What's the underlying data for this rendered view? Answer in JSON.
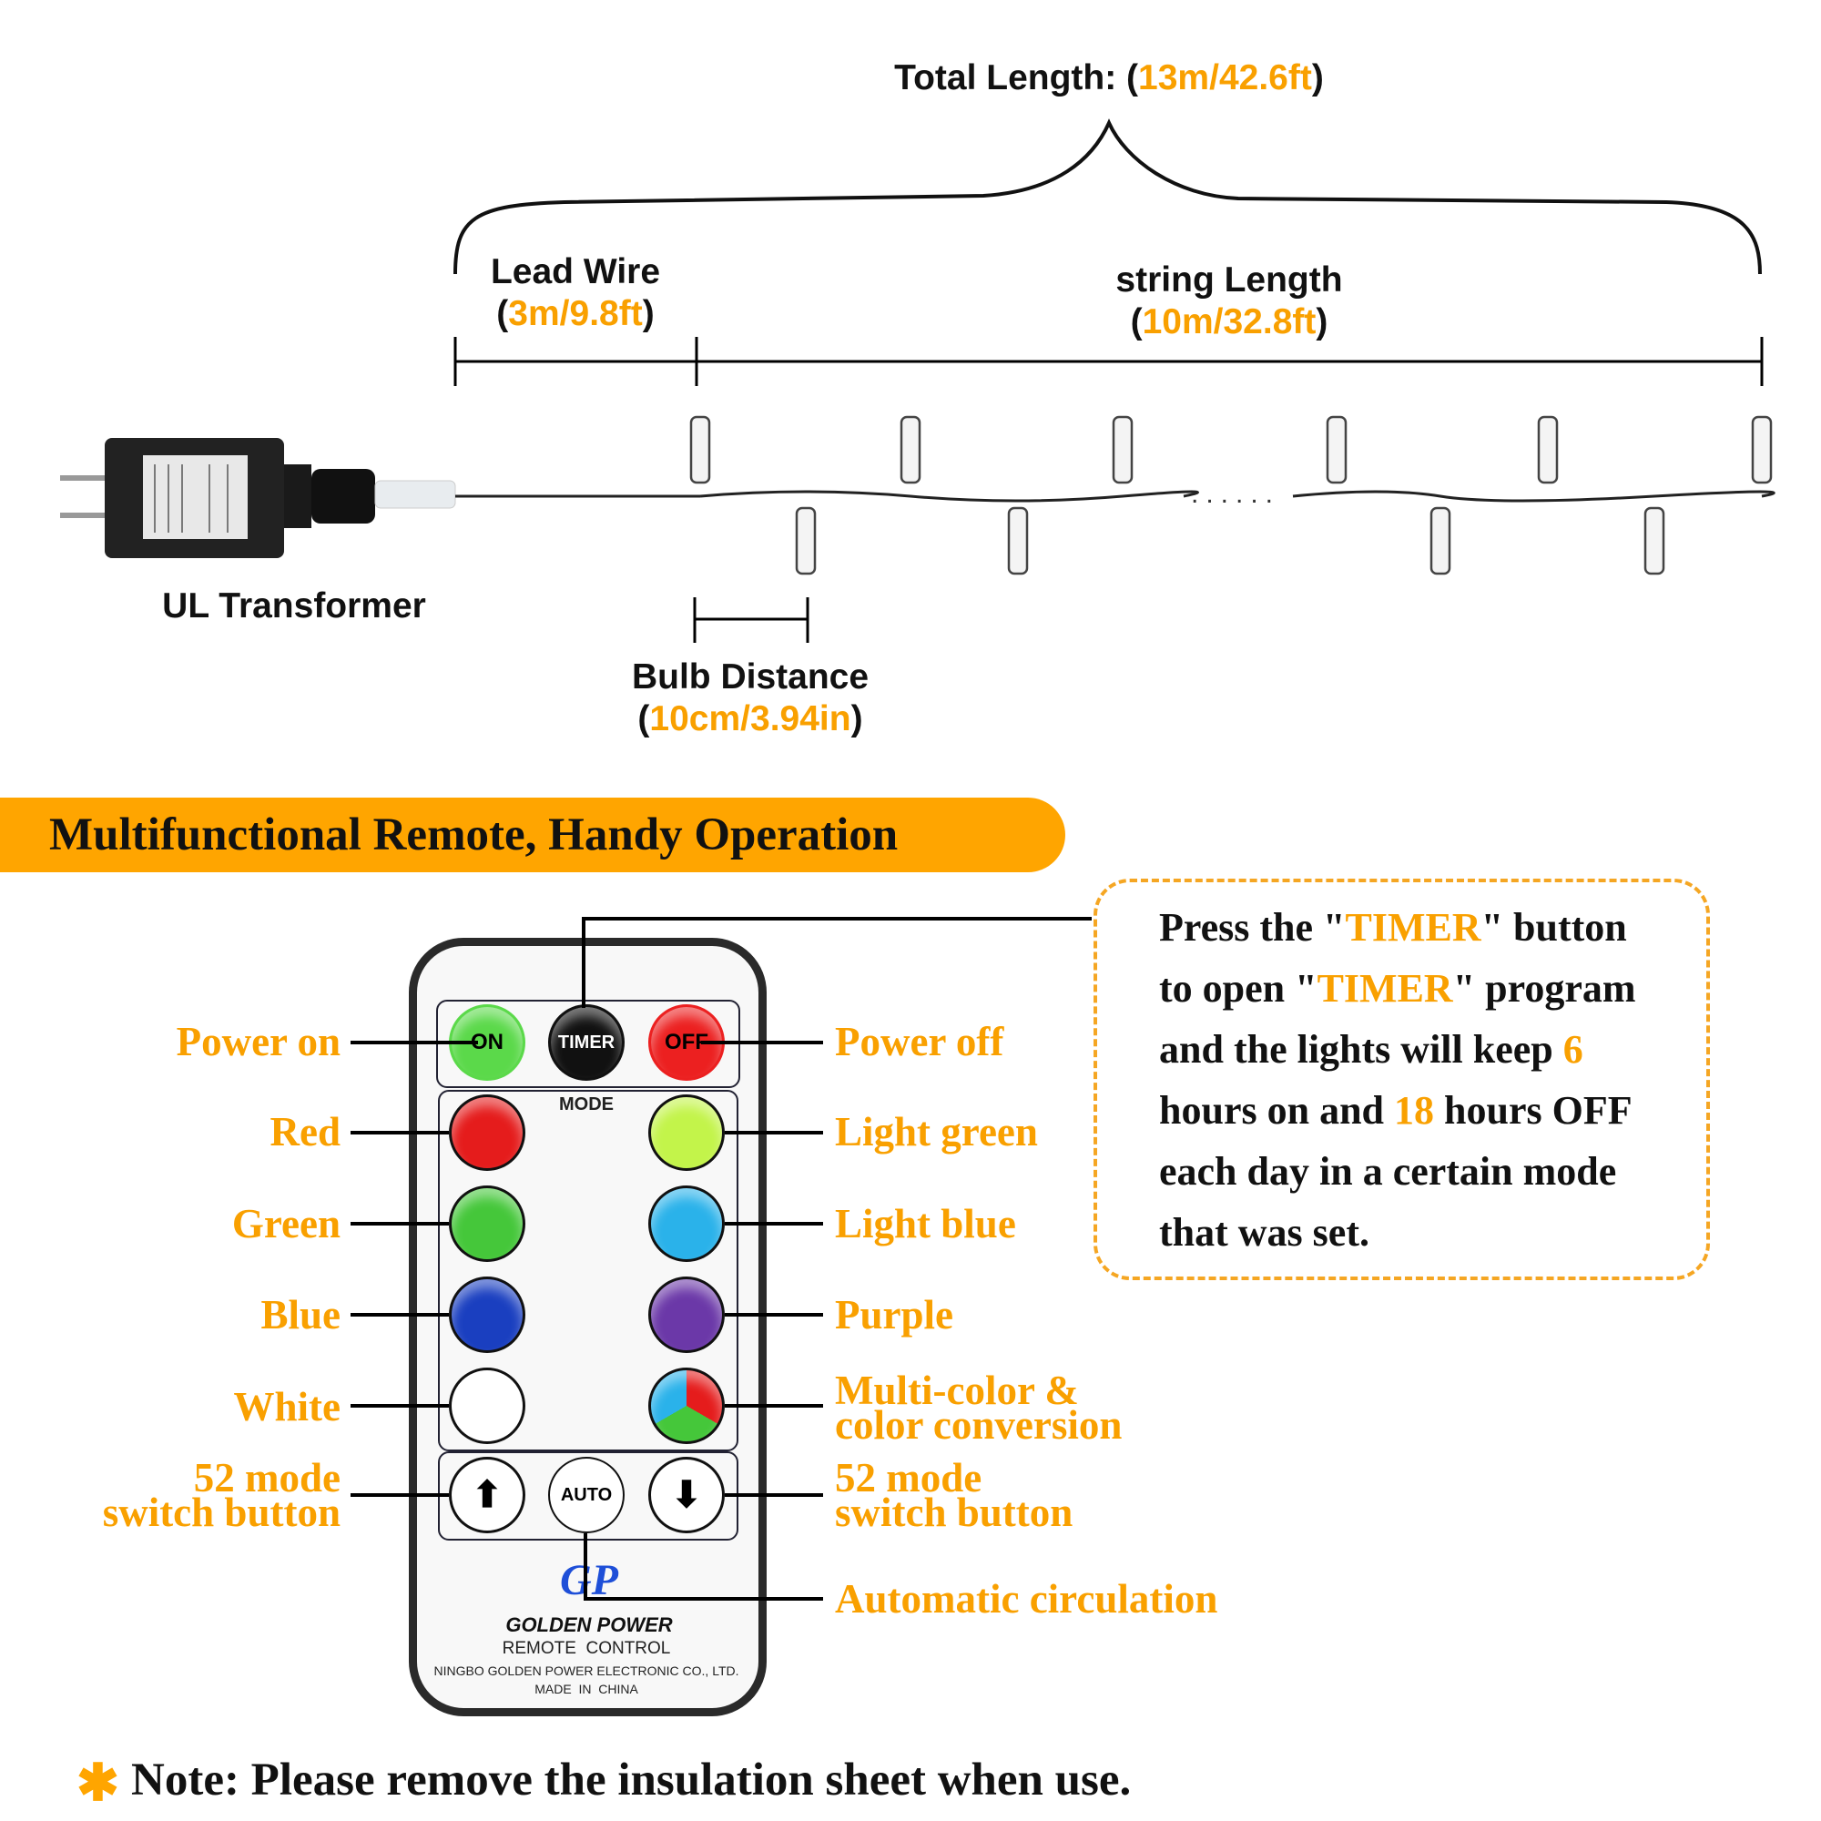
{
  "diagram": {
    "total_length": {
      "label": "Total Length: (",
      "value": "13m/42.6ft",
      "close": ")"
    },
    "lead_wire": {
      "label": "Lead Wire",
      "value": "3m/9.8ft"
    },
    "string_length": {
      "label": "string Length",
      "value": "10m/32.8ft"
    },
    "transformer": {
      "label": "UL Transformer"
    },
    "bulb_distance": {
      "label": "Bulb Distance",
      "value": "10cm/3.94in"
    }
  },
  "banner": {
    "title": "Multifunctional Remote, Handy Operation",
    "color": "#ffa500"
  },
  "timer_box": {
    "lines": [
      [
        "Press the \"",
        "TIMER",
        "\" button"
      ],
      [
        "to open \"",
        "TIMER",
        "\" program"
      ],
      [
        "and the lights will keep ",
        "6",
        ""
      ],
      [
        "hours on and ",
        "18",
        " hours OFF"
      ],
      [
        "each day in a certain mode",
        "",
        ""
      ],
      [
        "that was set.",
        "",
        ""
      ]
    ]
  },
  "remote": {
    "buttons": {
      "on": "ON",
      "timer": "TIMER",
      "off": "OFF",
      "mode": "MODE",
      "auto": "AUTO"
    },
    "brand": "GP",
    "brand_name": "GOLDEN POWER",
    "product": "REMOTE  CONTROL",
    "maker": "NINGBO GOLDEN POWER ELECTRONIC CO., LTD.",
    "origin": "MADE  IN  CHINA",
    "colors": {
      "red": "#e51c1c",
      "green": "#45c73a",
      "blue": "#1a3fc0",
      "white": "#ffffff",
      "light_green": "#c3f44a",
      "light_blue": "#2ab2ea",
      "purple": "#6b38a8"
    }
  },
  "labels": {
    "left": [
      "Power on",
      "Red",
      "Green",
      "Blue",
      "White",
      "52 mode",
      "switch button"
    ],
    "right": [
      "Power off",
      "Light green",
      "Light blue",
      "Purple",
      "Multi-color &",
      "color conversion",
      "52 mode",
      "switch button",
      "Automatic circulation"
    ]
  },
  "note": {
    "icon": "asterisk-icon",
    "text": "Note: Please remove the insulation sheet when use."
  }
}
